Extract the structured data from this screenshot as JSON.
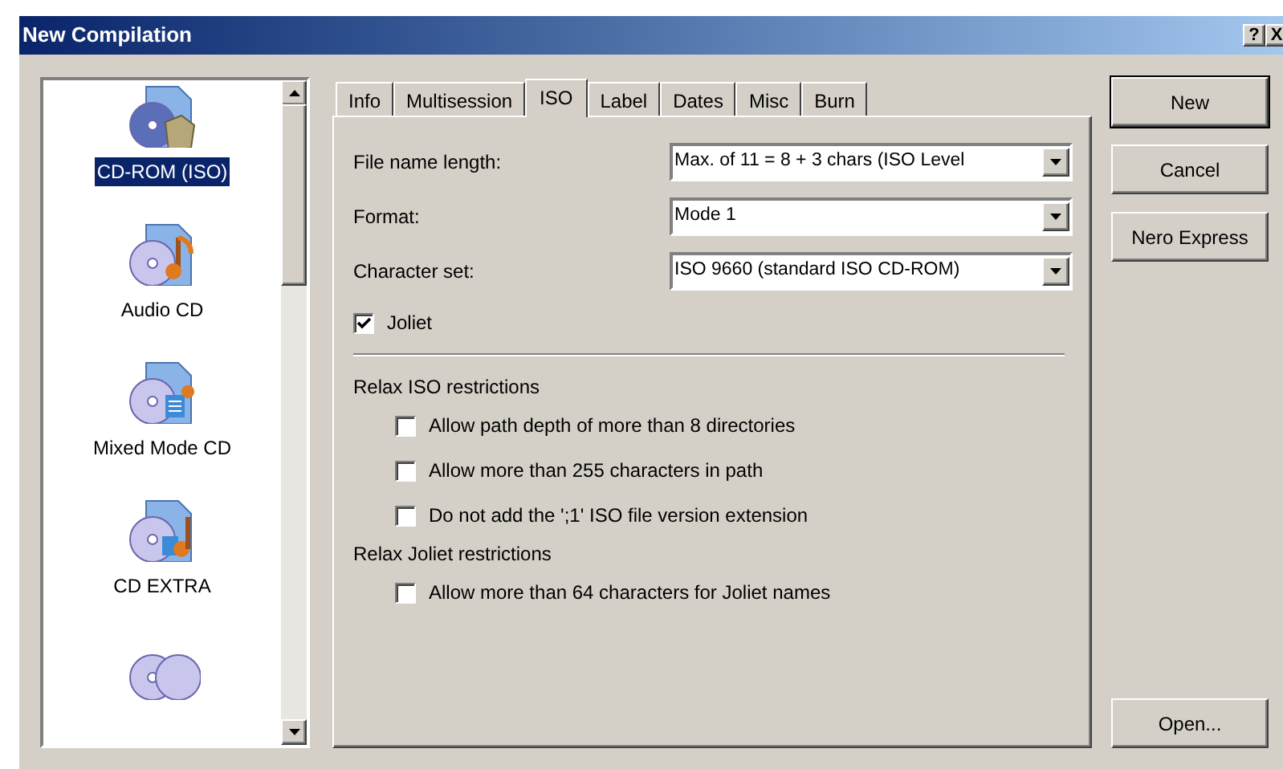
{
  "window": {
    "title": "New Compilation",
    "help_button": "?",
    "close_button": "X"
  },
  "types": [
    {
      "label": "CD-ROM (ISO)",
      "kind": "data",
      "selected": true
    },
    {
      "label": "Audio CD",
      "kind": "audio",
      "selected": false
    },
    {
      "label": "Mixed Mode CD",
      "kind": "mixed",
      "selected": false
    },
    {
      "label": "CD EXTRA",
      "kind": "extra",
      "selected": false
    },
    {
      "kind": "copy",
      "selected": false
    }
  ],
  "tabs": [
    {
      "label": "Info",
      "selected": false
    },
    {
      "label": "Multisession",
      "selected": false
    },
    {
      "label": "ISO",
      "selected": true
    },
    {
      "label": "Label",
      "selected": false
    },
    {
      "label": "Dates",
      "selected": false
    },
    {
      "label": "Misc",
      "selected": false
    },
    {
      "label": "Burn",
      "selected": false
    }
  ],
  "fields": [
    {
      "label": "File name length:",
      "value": "Max. of 11 = 8 + 3 chars (ISO Level"
    },
    {
      "label": "Format:",
      "value": "Mode 1"
    },
    {
      "label": "Character set:",
      "value": "ISO 9660 (standard ISO CD-ROM)"
    }
  ],
  "joliet": {
    "label": "Joliet",
    "checked": true
  },
  "groups": [
    {
      "title": "Relax ISO restrictions",
      "options": [
        {
          "label": "Allow path depth of more than 8 directories",
          "checked": false
        },
        {
          "label": "Allow more than 255 characters in path",
          "checked": false
        },
        {
          "label": "Do not add the ';1' ISO file version extension",
          "checked": false
        }
      ]
    },
    {
      "title": "Relax Joliet restrictions",
      "options": [
        {
          "label": "Allow more than 64 characters for Joliet names",
          "checked": false
        }
      ]
    }
  ],
  "buttons": [
    "New",
    "Cancel",
    "Nero Express"
  ],
  "bottom_button": "Open..."
}
